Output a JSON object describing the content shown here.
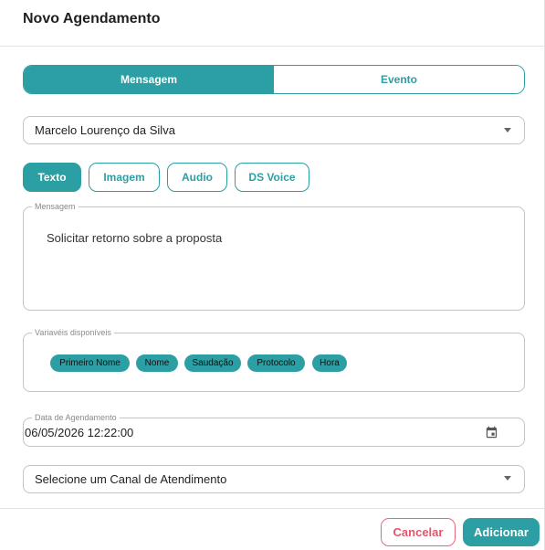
{
  "dialog": {
    "title": "Novo Agendamento"
  },
  "mode_toggle": {
    "options": [
      {
        "label": "Mensagem",
        "selected": true
      },
      {
        "label": "Evento",
        "selected": false
      }
    ]
  },
  "contact_select": {
    "value": "Marcelo Lourenço da Silva"
  },
  "message_types": [
    {
      "label": "Texto",
      "selected": true
    },
    {
      "label": "Imagem",
      "selected": false
    },
    {
      "label": "Audio",
      "selected": false
    },
    {
      "label": "DS Voice",
      "selected": false
    }
  ],
  "message_field": {
    "label": "Mensagem",
    "value": "Solicitar retorno sobre a proposta"
  },
  "variables": {
    "label": "Variavéis disponíveis",
    "chips": [
      "Primeiro Nome",
      "Nome",
      "Saudação",
      "Protocolo",
      "Hora"
    ]
  },
  "schedule_date": {
    "label": "Data de Agendamento",
    "value": "06/05/2026 12:22:00",
    "icon": "calendar-icon"
  },
  "channel_select": {
    "value": "Selecione um Canal de Atendimento"
  },
  "footer": {
    "cancel_label": "Cancelar",
    "add_label": "Adicionar"
  },
  "colors": {
    "accent": "#2b9fa3",
    "danger": "#e0566b",
    "border": "#c4c4c4"
  }
}
